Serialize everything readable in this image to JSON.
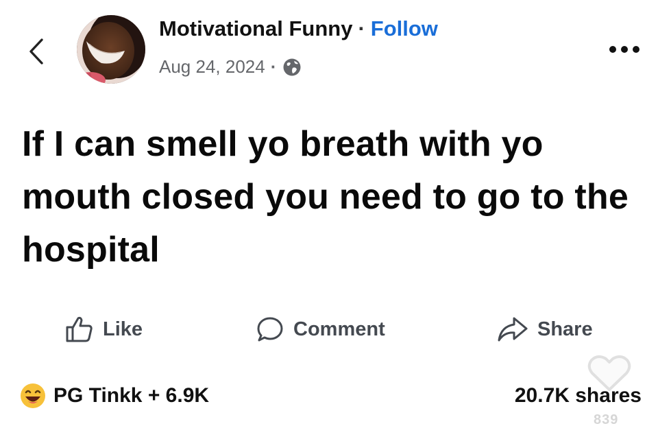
{
  "post": {
    "author": "Motivational Funny",
    "separator": "·",
    "follow_label": "Follow",
    "date": "Aug 24, 2024",
    "text": "If I can smell yo breath with yo mouth closed you need to go to the hospital"
  },
  "actions": {
    "like_label": "Like",
    "comment_label": "Comment",
    "share_label": "Share"
  },
  "footer": {
    "reactions_text": "PG Tinkk + 6.9K",
    "shares_text": "20.7K shares"
  },
  "overlay": {
    "count": "839"
  },
  "icons": {
    "back": "chevron-left-icon",
    "more": "more-horizontal-icon",
    "privacy": "globe-icon",
    "like": "thumbs-up-icon",
    "comment": "comment-bubble-icon",
    "share": "share-arrow-icon",
    "reaction": "laughing-emoji-icon",
    "overlay": "heart-outline-icon"
  },
  "colors": {
    "follow": "#1a6ed8",
    "meta_text": "#65676b",
    "action_text": "#444950",
    "emoji_face": "#f7c13a"
  }
}
